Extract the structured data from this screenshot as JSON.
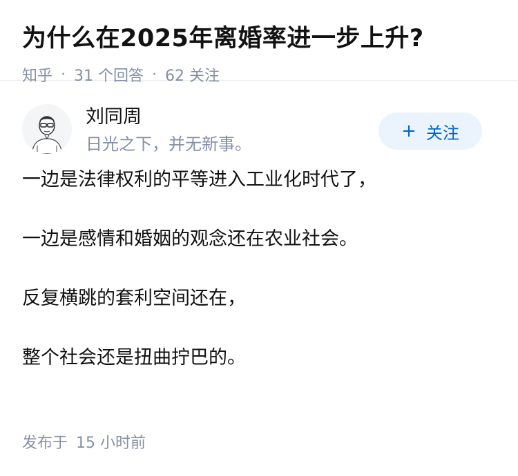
{
  "question": {
    "title": "为什么在2025年离婚率进一步上升?",
    "source": "知乎",
    "separator": "·",
    "answers_count": "31 个回答",
    "followers_count": "62 关注"
  },
  "author": {
    "name": "刘同周",
    "bio": "日光之下，并无新事。",
    "follow_icon": "plus-icon",
    "follow_plus": "+",
    "follow_label": "关注"
  },
  "answer": {
    "paragraphs": [
      "一边是法律权利的平等进入工业化时代了，",
      "一边是感情和婚姻的观念还在农业社会。",
      "反复横跳的套利空间还在，",
      "整个社会还是扭曲拧巴的。"
    ]
  },
  "footer": {
    "published_label": "发布于",
    "published_time": "15 小时前"
  },
  "colors": {
    "accent": "#0066cc",
    "accent_bg": "#ebf4fc",
    "muted": "#8590a6",
    "text": "#121212"
  }
}
